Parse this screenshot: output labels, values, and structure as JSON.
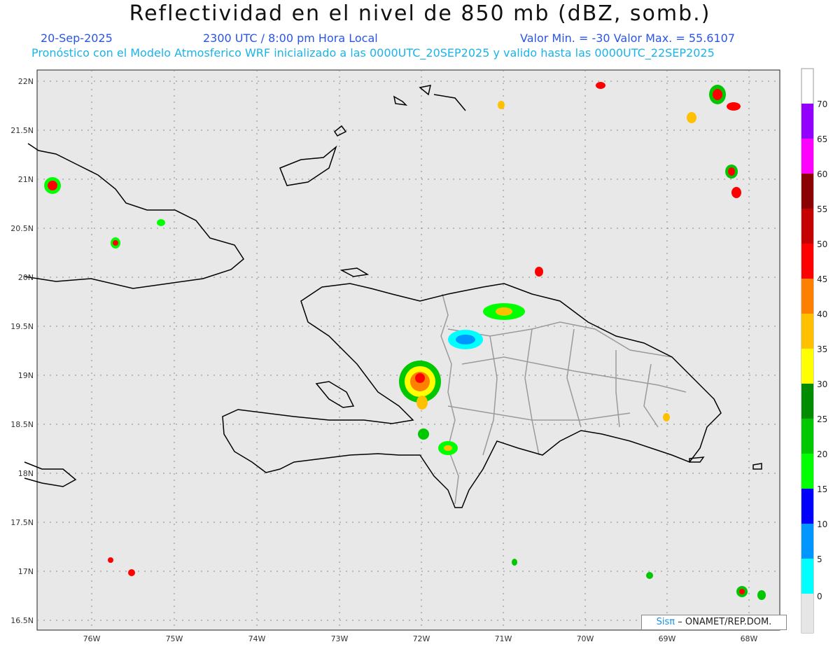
{
  "title": "Reflectividad en el nivel de 850 mb (dBZ, somb.)",
  "date": "20-Sep-2025",
  "time": "2300 UTC / 8:00 pm Hora Local",
  "minmax": "Valor Min. = -30  Valor Max. = 55.6107",
  "model_line": "Pronóstico con el Modelo Atmosferico WRF inicializado a las 0000UTC_20SEP2025 y valido hasta las  0000UTC_22SEP2025",
  "credit": {
    "brand": "Sisπ",
    "text": "– ONAMET/REP.DOM."
  },
  "lat_labels": [
    "22N",
    "21.5N",
    "21N",
    "20.5N",
    "20N",
    "19.5N",
    "19N",
    "18.5N",
    "18N",
    "17.5N",
    "17N",
    "16.5N"
  ],
  "lon_labels": [
    "76W",
    "75W",
    "74W",
    "73W",
    "72W",
    "71W",
    "70W",
    "69W",
    "68W"
  ],
  "colorbar": {
    "labels": [
      "70",
      "65",
      "60",
      "55",
      "50",
      "45",
      "40",
      "35",
      "30",
      "25",
      "20",
      "15",
      "10",
      "5",
      "0"
    ],
    "colors": [
      "#ffffff",
      "#9400ff",
      "#ff00ff",
      "#8b0000",
      "#c40000",
      "#ff0000",
      "#ff7f00",
      "#ffc000",
      "#ffff00",
      "#008c00",
      "#00c800",
      "#00ff00",
      "#0000ff",
      "#0096ff",
      "#00ffff",
      "#e6e6e6"
    ]
  }
}
